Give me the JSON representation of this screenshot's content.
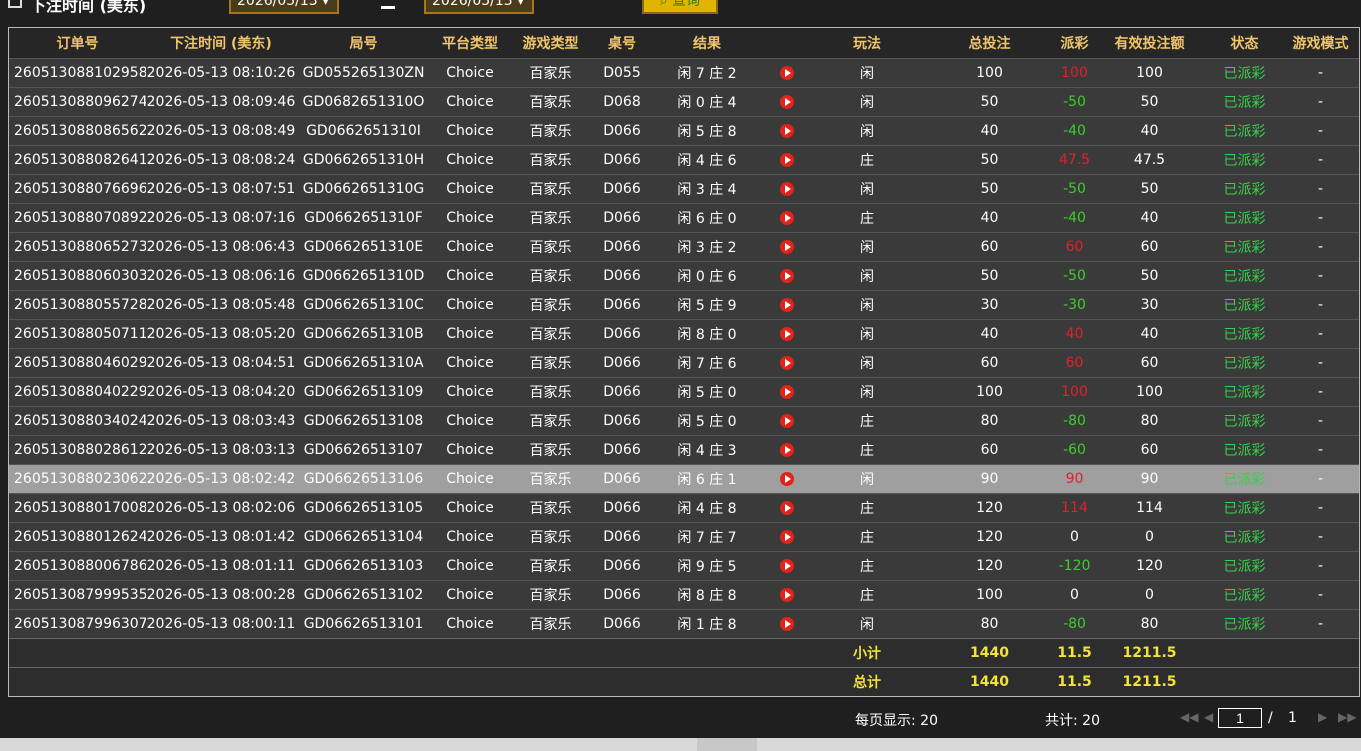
{
  "filter": {
    "label": "下注时间 (美东)",
    "date_from": "2026/05/13",
    "date_to": "2026/05/13",
    "query_label": "查询"
  },
  "columns": [
    "订单号",
    "下注时间 (美东)",
    "局号",
    "平台类型",
    "游戏类型",
    "桌号",
    "结果",
    "",
    "玩法",
    "总投注",
    "派彩",
    "有效投注额",
    "状态",
    "游戏模式"
  ],
  "rows": [
    {
      "order": "260513088102958",
      "time": "2026-05-13 08:10:26",
      "round": "GD055265130ZN",
      "platform": "Choice",
      "game": "百家乐",
      "table": "D055",
      "result": "闲 7 庄 2",
      "play": "闲",
      "bet": "100",
      "payout": "100",
      "payout_sign": "pos",
      "valid": "100",
      "status": "已派彩",
      "mode": "-"
    },
    {
      "order": "260513088096274",
      "time": "2026-05-13 08:09:46",
      "round": "GD0682651310O",
      "platform": "Choice",
      "game": "百家乐",
      "table": "D068",
      "result": "闲 0 庄 4",
      "play": "闲",
      "bet": "50",
      "payout": "-50",
      "payout_sign": "neg",
      "valid": "50",
      "status": "已派彩",
      "mode": "-"
    },
    {
      "order": "260513088086562",
      "time": "2026-05-13 08:08:49",
      "round": "GD0662651310I",
      "platform": "Choice",
      "game": "百家乐",
      "table": "D066",
      "result": "闲 5 庄 8",
      "play": "闲",
      "bet": "40",
      "payout": "-40",
      "payout_sign": "neg",
      "valid": "40",
      "status": "已派彩",
      "mode": "-"
    },
    {
      "order": "260513088082641",
      "time": "2026-05-13 08:08:24",
      "round": "GD0662651310H",
      "platform": "Choice",
      "game": "百家乐",
      "table": "D066",
      "result": "闲 4 庄 6",
      "play": "庄",
      "bet": "50",
      "payout": "47.5",
      "payout_sign": "pos",
      "valid": "47.5",
      "status": "已派彩",
      "mode": "-"
    },
    {
      "order": "260513088076696",
      "time": "2026-05-13 08:07:51",
      "round": "GD0662651310G",
      "platform": "Choice",
      "game": "百家乐",
      "table": "D066",
      "result": "闲 3 庄 4",
      "play": "闲",
      "bet": "50",
      "payout": "-50",
      "payout_sign": "neg",
      "valid": "50",
      "status": "已派彩",
      "mode": "-"
    },
    {
      "order": "260513088070892",
      "time": "2026-05-13 08:07:16",
      "round": "GD0662651310F",
      "platform": "Choice",
      "game": "百家乐",
      "table": "D066",
      "result": "闲 6 庄 0",
      "play": "庄",
      "bet": "40",
      "payout": "-40",
      "payout_sign": "neg",
      "valid": "40",
      "status": "已派彩",
      "mode": "-"
    },
    {
      "order": "260513088065273",
      "time": "2026-05-13 08:06:43",
      "round": "GD0662651310E",
      "platform": "Choice",
      "game": "百家乐",
      "table": "D066",
      "result": "闲 3 庄 2",
      "play": "闲",
      "bet": "60",
      "payout": "60",
      "payout_sign": "pos",
      "valid": "60",
      "status": "已派彩",
      "mode": "-"
    },
    {
      "order": "260513088060303",
      "time": "2026-05-13 08:06:16",
      "round": "GD0662651310D",
      "platform": "Choice",
      "game": "百家乐",
      "table": "D066",
      "result": "闲 0 庄 6",
      "play": "闲",
      "bet": "50",
      "payout": "-50",
      "payout_sign": "neg",
      "valid": "50",
      "status": "已派彩",
      "mode": "-"
    },
    {
      "order": "260513088055728",
      "time": "2026-05-13 08:05:48",
      "round": "GD0662651310C",
      "platform": "Choice",
      "game": "百家乐",
      "table": "D066",
      "result": "闲 5 庄 9",
      "play": "闲",
      "bet": "30",
      "payout": "-30",
      "payout_sign": "neg",
      "valid": "30",
      "status": "已派彩",
      "mode": "-"
    },
    {
      "order": "260513088050711",
      "time": "2026-05-13 08:05:20",
      "round": "GD0662651310B",
      "platform": "Choice",
      "game": "百家乐",
      "table": "D066",
      "result": "闲 8 庄 0",
      "play": "闲",
      "bet": "40",
      "payout": "40",
      "payout_sign": "pos",
      "valid": "40",
      "status": "已派彩",
      "mode": "-"
    },
    {
      "order": "260513088046029",
      "time": "2026-05-13 08:04:51",
      "round": "GD0662651310A",
      "platform": "Choice",
      "game": "百家乐",
      "table": "D066",
      "result": "闲 7 庄 6",
      "play": "闲",
      "bet": "60",
      "payout": "60",
      "payout_sign": "pos",
      "valid": "60",
      "status": "已派彩",
      "mode": "-"
    },
    {
      "order": "260513088040229",
      "time": "2026-05-13 08:04:20",
      "round": "GD06626513109",
      "platform": "Choice",
      "game": "百家乐",
      "table": "D066",
      "result": "闲 5 庄 0",
      "play": "闲",
      "bet": "100",
      "payout": "100",
      "payout_sign": "pos",
      "valid": "100",
      "status": "已派彩",
      "mode": "-"
    },
    {
      "order": "260513088034024",
      "time": "2026-05-13 08:03:43",
      "round": "GD06626513108",
      "platform": "Choice",
      "game": "百家乐",
      "table": "D066",
      "result": "闲 5 庄 0",
      "play": "庄",
      "bet": "80",
      "payout": "-80",
      "payout_sign": "neg",
      "valid": "80",
      "status": "已派彩",
      "mode": "-"
    },
    {
      "order": "260513088028612",
      "time": "2026-05-13 08:03:13",
      "round": "GD06626513107",
      "platform": "Choice",
      "game": "百家乐",
      "table": "D066",
      "result": "闲 4 庄 3",
      "play": "庄",
      "bet": "60",
      "payout": "-60",
      "payout_sign": "neg",
      "valid": "60",
      "status": "已派彩",
      "mode": "-"
    },
    {
      "order": "260513088023062",
      "time": "2026-05-13 08:02:42",
      "round": "GD06626513106",
      "platform": "Choice",
      "game": "百家乐",
      "table": "D066",
      "result": "闲 6 庄 1",
      "play": "闲",
      "bet": "90",
      "payout": "90",
      "payout_sign": "pos",
      "valid": "90",
      "status": "已派彩",
      "mode": "-",
      "selected": true
    },
    {
      "order": "260513088017008",
      "time": "2026-05-13 08:02:06",
      "round": "GD06626513105",
      "platform": "Choice",
      "game": "百家乐",
      "table": "D066",
      "result": "闲 4 庄 8",
      "play": "庄",
      "bet": "120",
      "payout": "114",
      "payout_sign": "pos",
      "valid": "114",
      "status": "已派彩",
      "mode": "-"
    },
    {
      "order": "260513088012624",
      "time": "2026-05-13 08:01:42",
      "round": "GD06626513104",
      "platform": "Choice",
      "game": "百家乐",
      "table": "D066",
      "result": "闲 7 庄 7",
      "play": "庄",
      "bet": "120",
      "payout": "0",
      "payout_sign": "zero",
      "valid": "0",
      "status": "已派彩",
      "mode": "-"
    },
    {
      "order": "260513088006786",
      "time": "2026-05-13 08:01:11",
      "round": "GD06626513103",
      "platform": "Choice",
      "game": "百家乐",
      "table": "D066",
      "result": "闲 9 庄 5",
      "play": "庄",
      "bet": "120",
      "payout": "-120",
      "payout_sign": "neg",
      "valid": "120",
      "status": "已派彩",
      "mode": "-"
    },
    {
      "order": "260513087999535",
      "time": "2026-05-13 08:00:28",
      "round": "GD06626513102",
      "platform": "Choice",
      "game": "百家乐",
      "table": "D066",
      "result": "闲 8 庄 8",
      "play": "庄",
      "bet": "100",
      "payout": "0",
      "payout_sign": "zero",
      "valid": "0",
      "status": "已派彩",
      "mode": "-"
    },
    {
      "order": "260513087996307",
      "time": "2026-05-13 08:00:11",
      "round": "GD06626513101",
      "platform": "Choice",
      "game": "百家乐",
      "table": "D066",
      "result": "闲 1 庄 8",
      "play": "闲",
      "bet": "80",
      "payout": "-80",
      "payout_sign": "neg",
      "valid": "80",
      "status": "已派彩",
      "mode": "-"
    }
  ],
  "subtotal": {
    "label": "小计",
    "bet": "1440",
    "payout": "11.5",
    "valid": "1211.5"
  },
  "total": {
    "label": "总计",
    "bet": "1440",
    "payout": "11.5",
    "valid": "1211.5"
  },
  "pager": {
    "per_page": "每页显示: 20",
    "total": "共计: 20",
    "current": "1",
    "sep": "/",
    "pages": "1"
  },
  "colors": {
    "header_text": "#f0c46a",
    "positive": "#e0212b",
    "negative": "#3ccf2a",
    "status": "#35d14a",
    "summary": "#f2e23a"
  }
}
